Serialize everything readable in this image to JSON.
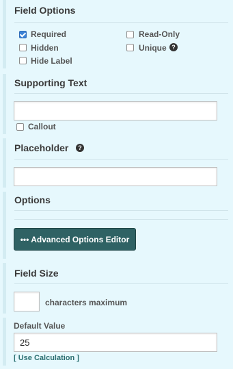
{
  "field_options": {
    "title": "Field Options",
    "required": {
      "label": "Required",
      "checked": true
    },
    "read_only": {
      "label": "Read-Only",
      "checked": false
    },
    "hidden": {
      "label": "Hidden",
      "checked": false
    },
    "unique": {
      "label": "Unique",
      "checked": false
    },
    "hide_label": {
      "label": "Hide Label",
      "checked": false
    }
  },
  "supporting_text": {
    "title": "Supporting Text",
    "value": "",
    "callout": {
      "label": "Callout",
      "checked": false
    }
  },
  "placeholder": {
    "title": "Placeholder",
    "value": ""
  },
  "options": {
    "title": "Options",
    "advanced_button": "••• Advanced Options Editor"
  },
  "field_size": {
    "title": "Field Size",
    "value": "",
    "suffix": "characters maximum"
  },
  "default_value": {
    "label": "Default Value",
    "value": "25",
    "calc_link": "[ Use Calculation ]"
  },
  "colors": {
    "background": "#e6f8fd",
    "button": "#2f6264",
    "accent": "#3b82d6",
    "link": "#2b6f71"
  },
  "icons": {
    "help": "question-circle-icon",
    "check": "check-icon"
  }
}
